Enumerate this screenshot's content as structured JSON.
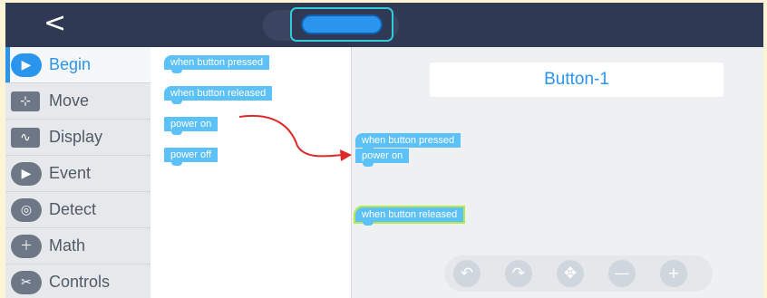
{
  "header": {
    "back_icon": "<"
  },
  "sidebar": {
    "items": [
      {
        "label": "Begin",
        "icon": "▶"
      },
      {
        "label": "Move",
        "icon": "⊹"
      },
      {
        "label": "Display",
        "icon": "∿"
      },
      {
        "label": "Event",
        "icon": "▶"
      },
      {
        "label": "Detect",
        "icon": "◎"
      },
      {
        "label": "Math",
        "icon": "＋"
      },
      {
        "label": "Controls",
        "icon": "✂"
      }
    ]
  },
  "palette": {
    "blocks": [
      {
        "label": "when button pressed"
      },
      {
        "label": "when button released"
      },
      {
        "label": "power on"
      },
      {
        "label": "power off"
      }
    ]
  },
  "canvas": {
    "title": "Button-1",
    "script_hat": "when button pressed",
    "script_cmd": "power on",
    "released_hat": "when button released"
  },
  "toolbar": {
    "undo_icon": "↶",
    "redo_icon": "↷",
    "move_icon": "✥",
    "zoom_out_icon": "—",
    "zoom_in_icon": "+"
  },
  "colors": {
    "accent": "#2b95ee",
    "block": "#5cc1f6",
    "arrow": "#e02828",
    "header": "#2f3954"
  }
}
